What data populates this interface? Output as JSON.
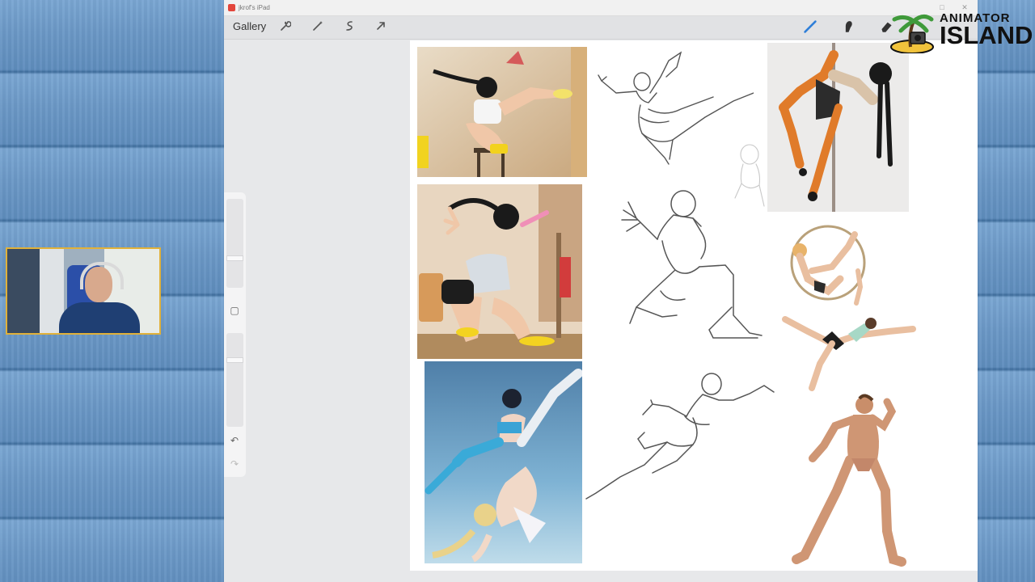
{
  "window": {
    "title": "jkrof's iPad"
  },
  "toolbar": {
    "gallery_label": "Gallery",
    "left_tools": [
      "wrench-icon",
      "magic-wand-icon",
      "selection-icon",
      "transform-arrow-icon"
    ],
    "right_tools": [
      "brush-icon",
      "smudge-icon",
      "eraser-icon"
    ],
    "active_tool": "brush-icon",
    "accent": "#2f7fd8"
  },
  "logo": {
    "line1": "ANIMATOR",
    "line2": "ISLAND"
  },
  "sidebar": {
    "buttons": [
      "square-modify-icon",
      "undo-icon",
      "redo-icon"
    ]
  },
  "canvas": {
    "photos": [
      "pose-photo-fan-kick",
      "pose-photo-lunge",
      "pose-photo-underwater",
      "pose-photo-pole",
      "pose-photo-hoop-acrobats",
      "pose-photo-male-dancer"
    ],
    "sketches": [
      "gesture-sketch-1",
      "gesture-sketch-2",
      "gesture-sketch-3",
      "gesture-sketch-small"
    ]
  }
}
